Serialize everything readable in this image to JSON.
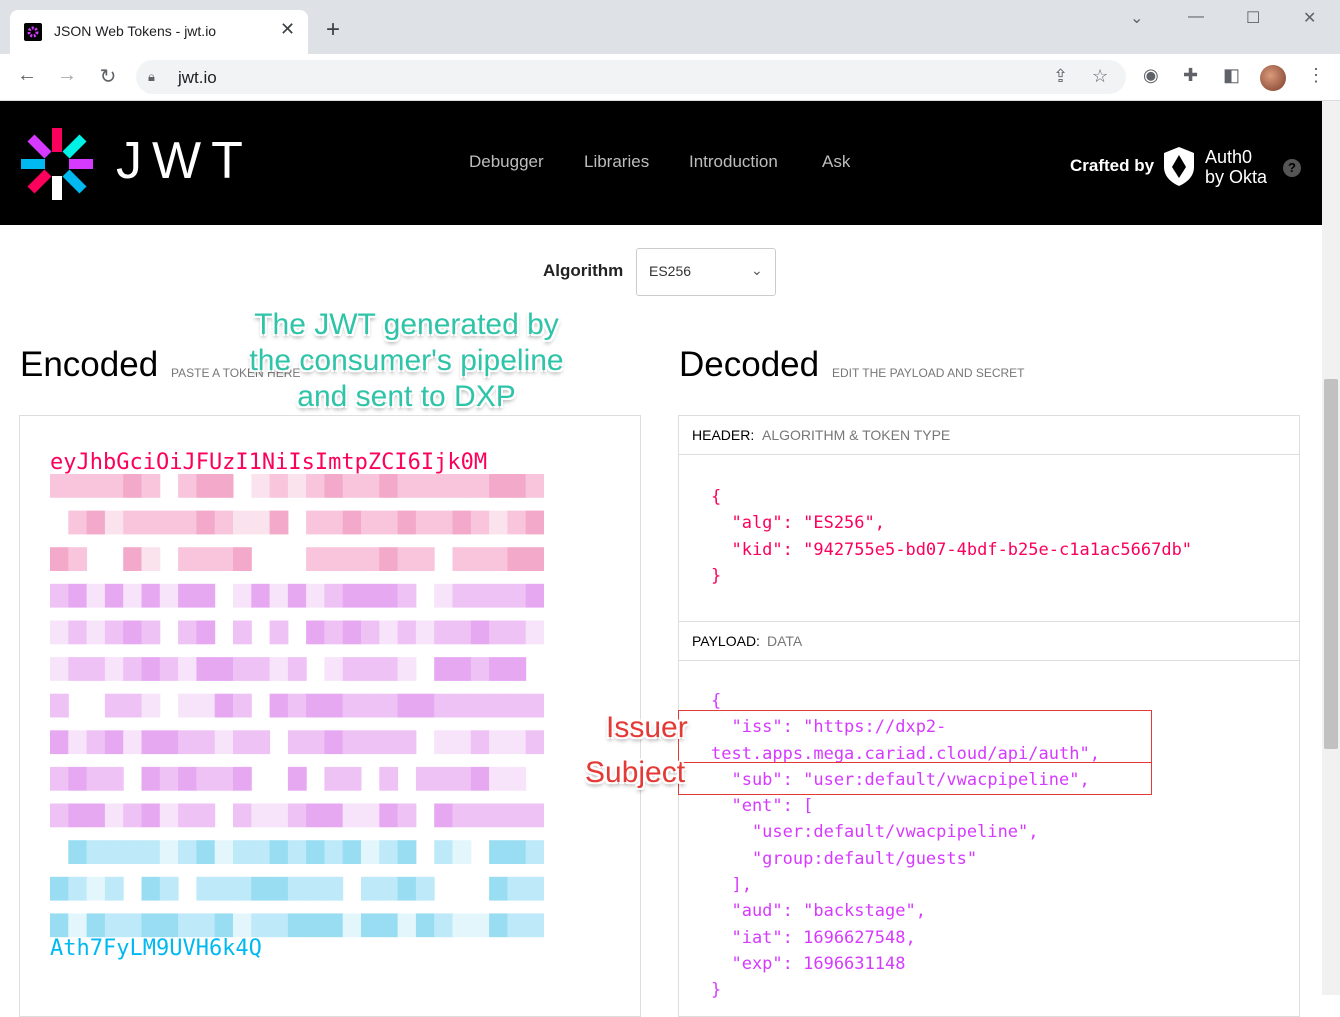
{
  "browser": {
    "tab_title": "JSON Web Tokens - jwt.io",
    "url": "jwt.io"
  },
  "site": {
    "wordmark": "JWT",
    "nav": [
      "Debugger",
      "Libraries",
      "Introduction",
      "Ask"
    ],
    "crafted_by": "Crafted by",
    "auth0_line1": "Auth0",
    "auth0_line2": "by Okta",
    "help": "?"
  },
  "algorithm": {
    "label": "Algorithm",
    "selected": "ES256"
  },
  "encoded": {
    "title": "Encoded",
    "subtitle": "PASTE A TOKEN HERE",
    "first_line": "eyJhbGciOiJFUzI1NiIsImtpZCI6Ijk0M",
    "last_line": "Ath7FyLM9UVH6k4Q"
  },
  "decoded": {
    "title": "Decoded",
    "subtitle": "EDIT THE PAYLOAD AND SECRET",
    "header_label": "HEADER:",
    "header_desc": "ALGORITHM & TOKEN TYPE",
    "header_json": "{\n  \"alg\": \"ES256\",\n  \"kid\": \"942755e5-bd07-4bdf-b25e-c1a1ac5667db\"\n}",
    "payload_label": "PAYLOAD:",
    "payload_desc": "DATA",
    "payload_json": "{\n  \"iss\": \"https://dxp2-\ntest.apps.mega.cariad.cloud/api/auth\",\n  \"sub\": \"user:default/vwacpipeline\",\n  \"ent\": [\n    \"user:default/vwacpipeline\",\n    \"group:default/guests\"\n  ],\n  \"aud\": \"backstage\",\n  \"iat\": 1696627548,\n  \"exp\": 1696631148\n}"
  },
  "annotations": {
    "green_line1": "The JWT generated by",
    "green_line2": "the consumer's pipeline",
    "green_line3": "and sent to DXP",
    "issuer": "Issuer",
    "subject": "Subject"
  },
  "colors": {
    "header_bg": "#000000",
    "token_red": "#fb015b",
    "token_purple": "#d63aff",
    "token_blue": "#00b9f1",
    "annotation_green": "#2ec4a8",
    "annotation_red": "#e53935"
  }
}
